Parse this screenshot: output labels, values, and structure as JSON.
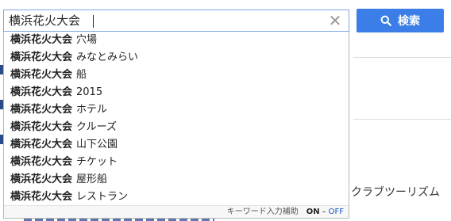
{
  "search": {
    "query": "横浜花火大会",
    "clear_icon": "close-icon",
    "button_label": "検索",
    "button_icon": "search-icon",
    "button_color": "#3b7ee8",
    "border_color": "#7fa6e6"
  },
  "suggestions": {
    "keyword": "横浜花火大会",
    "items": [
      {
        "suffix": "穴場"
      },
      {
        "suffix": "みなとみらい"
      },
      {
        "suffix": "船"
      },
      {
        "suffix": "2015"
      },
      {
        "suffix": "ホテル"
      },
      {
        "suffix": "クルーズ"
      },
      {
        "suffix": "山下公園"
      },
      {
        "suffix": "チケット"
      },
      {
        "suffix": "屋形船"
      },
      {
        "suffix": "レストラン"
      }
    ],
    "footer": {
      "label": "キーワード入力補助",
      "on": "ON",
      "separator": "–",
      "off": "OFF"
    }
  },
  "background": {
    "partial_text": "クラブツーリズム"
  }
}
